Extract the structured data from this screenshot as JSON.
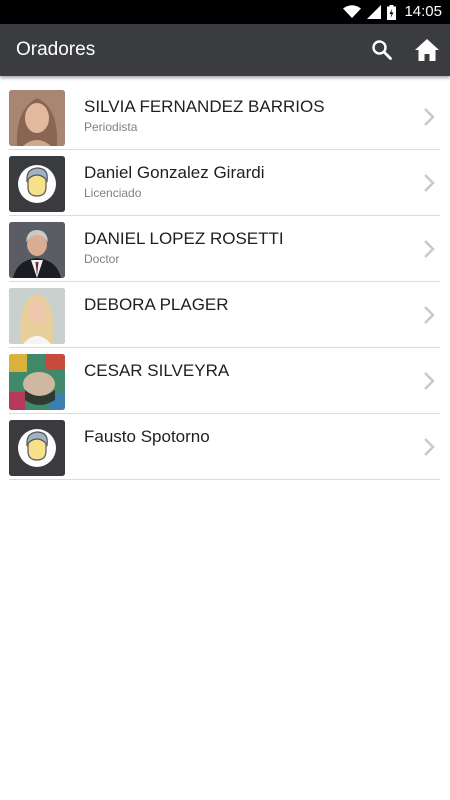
{
  "status_bar": {
    "time": "14:05"
  },
  "app_bar": {
    "title": "Oradores"
  },
  "speakers": [
    {
      "name": "SILVIA FERNANDEZ BARRIOS",
      "subtitle": "Periodista"
    },
    {
      "name": "Daniel Gonzalez Girardi",
      "subtitle": "Licenciado"
    },
    {
      "name": "DANIEL LOPEZ ROSETTI",
      "subtitle": "Doctor"
    },
    {
      "name": "DEBORA PLAGER",
      "subtitle": ""
    },
    {
      "name": "CESAR SILVEYRA",
      "subtitle": ""
    },
    {
      "name": "Fausto Spotorno",
      "subtitle": ""
    }
  ]
}
